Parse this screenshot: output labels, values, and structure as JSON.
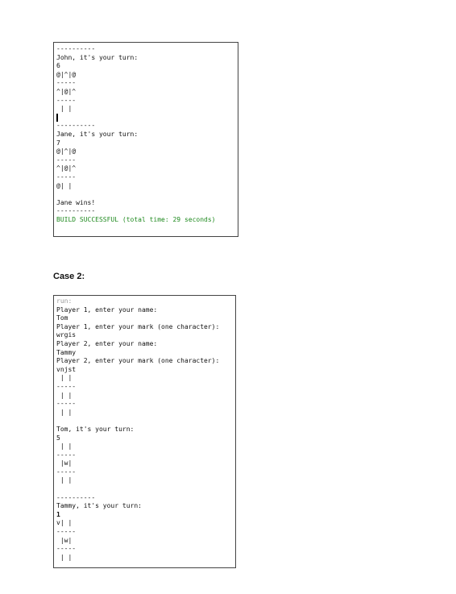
{
  "console1": {
    "lines": [
      "----------",
      "John, it's your turn:",
      "6",
      "@|^|@",
      "-----",
      "^|@|^",
      "-----",
      " | |",
      "",
      "----------",
      "Jane, it's your turn:",
      "7",
      "@|^|@",
      "-----",
      "^|@|^",
      "-----",
      "@| |",
      "",
      "Jane wins!",
      "----------",
      "BUILD SUCCESSFUL (total time: 29 seconds)"
    ]
  },
  "case2_heading": "Case 2:",
  "console2": {
    "lines": [
      "run:",
      "Player 1, enter your name:",
      "Tom",
      "Player 1, enter your mark (one character):",
      "wrgis",
      "Player 2, enter your name:",
      "Tammy",
      "Player 2, enter your mark (one character):",
      "vnjst",
      " | |",
      "-----",
      " | |",
      "-----",
      " | |",
      "",
      "Tom, it's your turn:",
      "5",
      " | |",
      "-----",
      " |w|",
      "-----",
      " | |",
      "",
      "----------",
      "Tammy, it's your turn:",
      "1",
      "v| |",
      "-----",
      " |w|",
      "-----",
      " | |"
    ]
  }
}
